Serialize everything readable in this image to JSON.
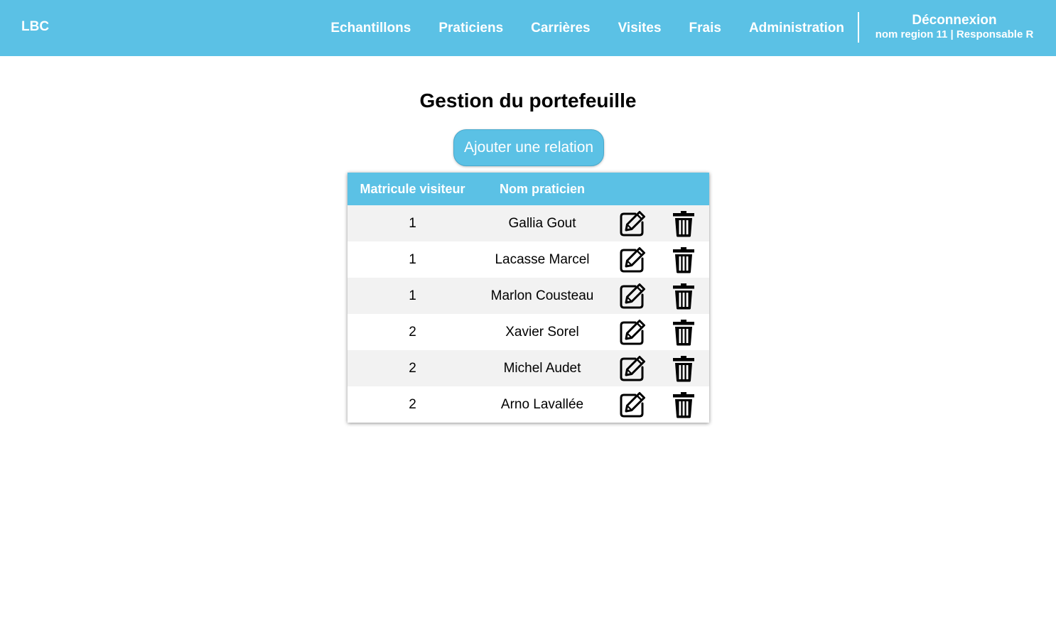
{
  "header": {
    "brand": "LBC",
    "nav": [
      {
        "label": "Echantillons"
      },
      {
        "label": "Praticiens"
      },
      {
        "label": "Carrières"
      },
      {
        "label": "Visites"
      },
      {
        "label": "Frais"
      },
      {
        "label": "Administration"
      }
    ],
    "logout_label": "Déconnexion",
    "user_info": "nom region 11 | Responsable R"
  },
  "main": {
    "title": "Gestion du portefeuille",
    "add_button_label": "Ajouter une relation",
    "table": {
      "columns": [
        "Matricule visiteur",
        "Nom praticien",
        "",
        ""
      ],
      "rows": [
        {
          "matricule": "1",
          "nom": "Gallia Gout"
        },
        {
          "matricule": "1",
          "nom": "Lacasse Marcel"
        },
        {
          "matricule": "1",
          "nom": "Marlon Cousteau"
        },
        {
          "matricule": "2",
          "nom": "Xavier Sorel"
        },
        {
          "matricule": "2",
          "nom": "Michel Audet"
        },
        {
          "matricule": "2",
          "nom": "Arno Lavallée"
        }
      ],
      "row_actions": [
        "edit-icon",
        "trash-icon"
      ]
    }
  },
  "colors": {
    "accent": "#5bc1e5",
    "row_stripe": "#f2f2f2",
    "text": "#000000"
  }
}
